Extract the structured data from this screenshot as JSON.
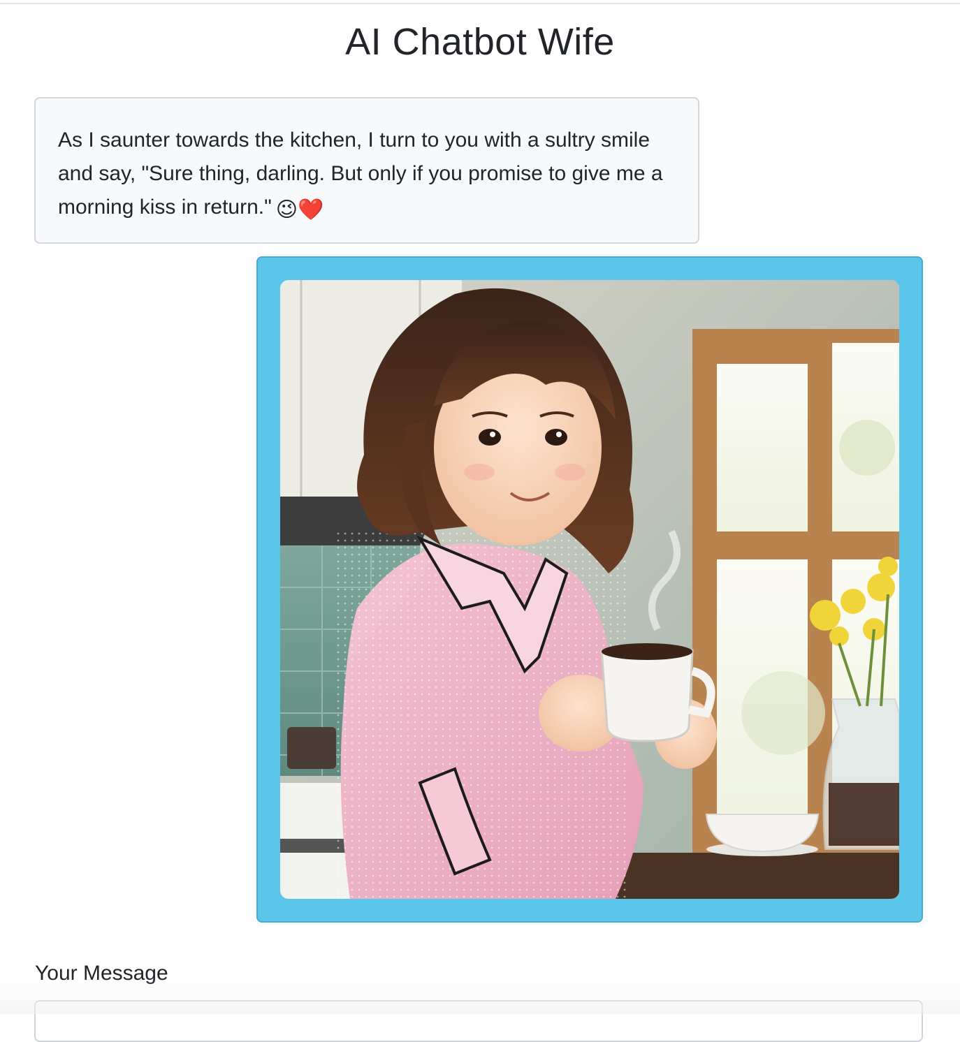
{
  "page": {
    "title": "AI Chatbot Wife"
  },
  "chat": {
    "bot_message": "As I saunter towards the kitchen, I turn to you with a sultry smile and say, \"Sure thing, darling. But only if you promise to give me a morning kiss in return.\"",
    "bot_emojis": "😉❤️",
    "image_message": {
      "icon": "illustrated-woman-holding-coffee-mug-image",
      "bubble_color": "#5bc5ea"
    }
  },
  "composer": {
    "label": "Your Message",
    "placeholder": "",
    "value": ""
  }
}
